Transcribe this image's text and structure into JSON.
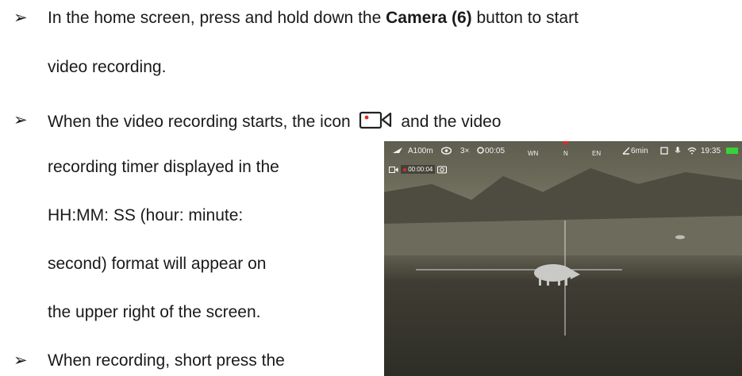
{
  "bullets": [
    {
      "lines": [
        {
          "before": "In the home screen, press and hold down the ",
          "bold": "Camera (6)",
          "after": " button to start"
        },
        {
          "text": "video recording."
        }
      ]
    },
    {
      "lines": [
        {
          "before": "When the video recording starts, the icon ",
          "after": " and the video"
        },
        {
          "text": "recording timer displayed in the"
        },
        {
          "text": "HH:MM: SS (hour: minute:"
        },
        {
          "text": "second) format will appear on"
        },
        {
          "text": "the upper right of the screen."
        }
      ]
    },
    {
      "lines": [
        {
          "text": "When recording, short press the"
        }
      ]
    }
  ],
  "bullet_symbol": "➢",
  "thermal_hud": {
    "range": "A100m",
    "zoom": "3×",
    "timer": "00:05",
    "compass_left": "WN",
    "compass_center": "N",
    "compass_right": "EN",
    "battery_time": "6min",
    "clock": "19:35",
    "rec_time": "00:00:04",
    "battery_color": "#37d23a"
  }
}
